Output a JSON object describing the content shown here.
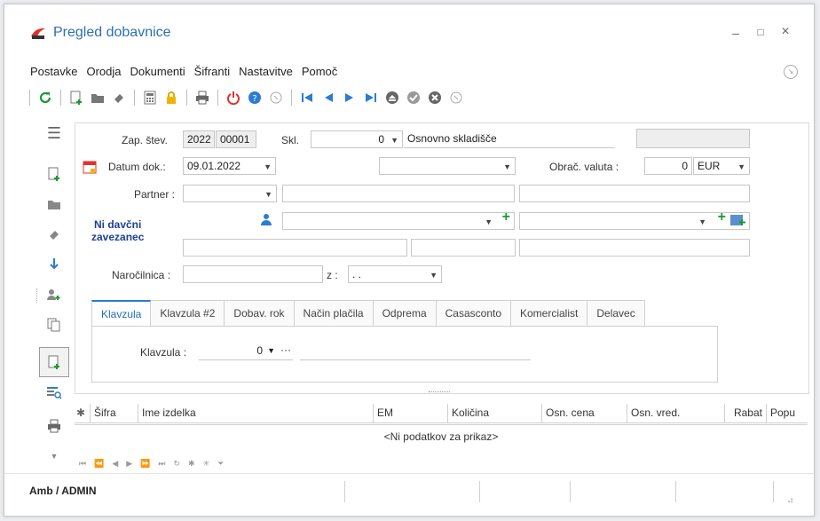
{
  "window": {
    "title": "Pregled dobavnice",
    "minimize": "–",
    "maximize": "□",
    "close": "×"
  },
  "menu": [
    "Postavke",
    "Orodja",
    "Dokumenti",
    "Šifranti",
    "Nastavitve",
    "Pomoč"
  ],
  "icons": {
    "refresh": "refresh-icon",
    "new": "new-document-icon",
    "open": "folder-icon",
    "erase": "eraser-icon",
    "calc": "calculator-icon",
    "lock": "lock-icon",
    "print": "print-icon",
    "power": "power-icon",
    "help": "help-icon"
  },
  "colors": {
    "accent": "#2b7cd3",
    "title": "#2b6fb8",
    "green": "#1a9a32",
    "red": "#e0322b"
  },
  "header": {
    "doc_no_label": "Zap. štev.",
    "doc_year": "2022",
    "doc_no": "00001",
    "warehouse_label": "Skl.",
    "warehouse_code": "0",
    "warehouse_name": "Osnovno skladišče"
  },
  "form": {
    "date_label": "Datum dok.:",
    "date_value": "09.01.2022",
    "currency_label": "Obrač. valuta :",
    "currency_rate": "0",
    "currency": "EUR",
    "partner_label": "Partner :",
    "tax_status_line1": "Ni davčni",
    "tax_status_line2": "zavezanec",
    "order_label": "Naročilnica :",
    "order_from_label": "z :",
    "order_date": ". ."
  },
  "tabs": [
    "Klavzula",
    "Klavzula #2",
    "Dobav. rok",
    "Način plačila",
    "Odprema",
    "Casasconto",
    "Komercialist",
    "Delavec"
  ],
  "tab_panel": {
    "klavzula_label": "Klavzula :",
    "klavzula_value": "0",
    "more": "···"
  },
  "grid": {
    "columns": [
      "Šifra",
      "Ime izdelka",
      "EM",
      "Količina",
      "Osn. cena",
      "Osn. vred.",
      "Rabat",
      "Popu"
    ],
    "empty_text": "<Ni podatkov za prikaz>"
  },
  "status": {
    "user": "Amb / ADMIN"
  }
}
